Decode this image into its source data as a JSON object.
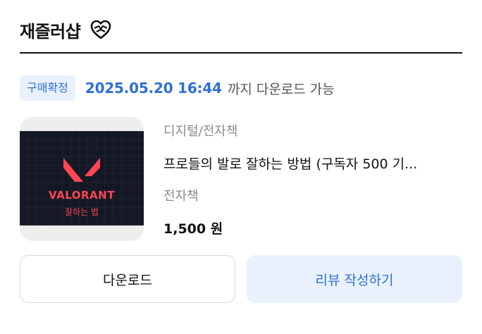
{
  "header": {
    "shop_name": "재즐러샵",
    "icon": "heart-icon"
  },
  "order": {
    "status_badge": "구매확정",
    "download_deadline": "2025.05.20 16:44",
    "deadline_suffix": "까지 다운로드 가능"
  },
  "product": {
    "category": "디지털/전자책",
    "title": "프로들의 발로 잘하는 방법 (구독자 500 기...",
    "type": "전자책",
    "price": "1,500 원",
    "thumbnail": {
      "logo_text": "VALORANT",
      "subtitle": "잘하는 법",
      "accent_color": "#ff4655",
      "background_color": "#141824"
    }
  },
  "actions": {
    "download_label": "다운로드",
    "review_label": "리뷰 작성하기"
  },
  "colors": {
    "accent": "#2f6fd8",
    "accent_bg": "#e9f1fd"
  }
}
